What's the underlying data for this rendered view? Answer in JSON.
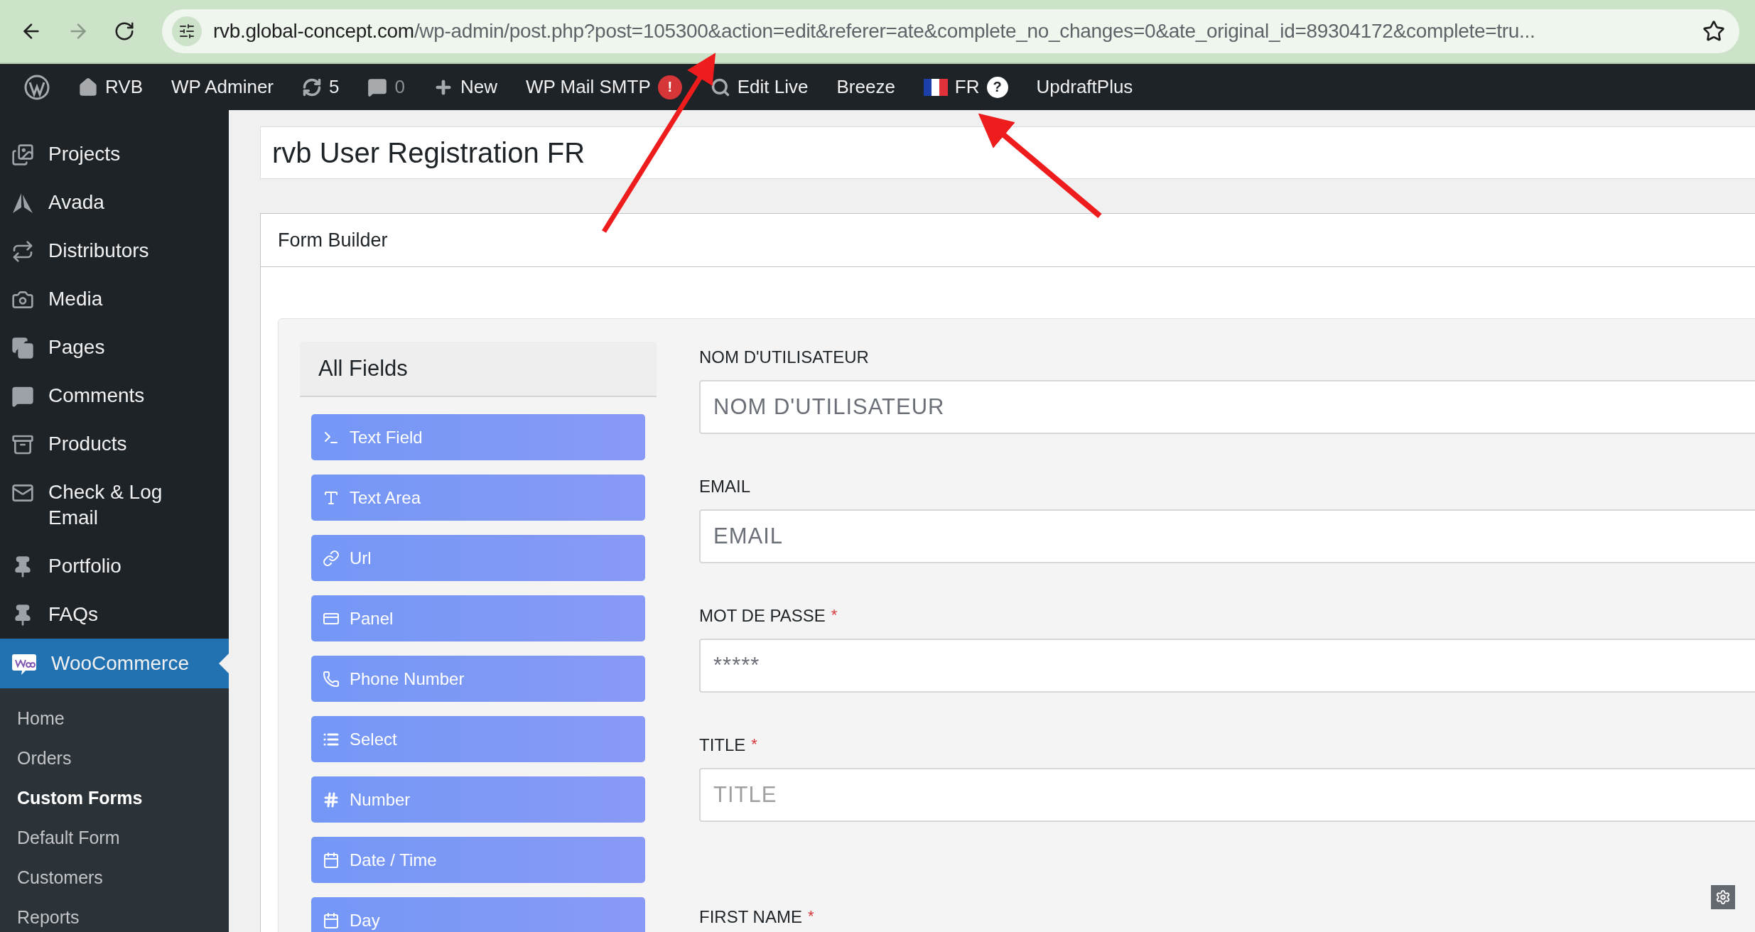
{
  "browser": {
    "url_host": "rvb.global-concept.com",
    "url_path": "/wp-admin/post.php?post=105300&action=edit&referer=ate&complete_no_changes=0&ate_original_id=89304172&complete=tru..."
  },
  "admin_bar": [
    {
      "kind": "wp-logo"
    },
    {
      "kind": "home",
      "label": "RVB"
    },
    {
      "kind": "text",
      "label": "WP Adminer"
    },
    {
      "kind": "updates",
      "label": "5"
    },
    {
      "kind": "comments",
      "label": "0"
    },
    {
      "kind": "new",
      "label": "New"
    },
    {
      "kind": "alert",
      "label": "WP Mail SMTP",
      "badge": "!"
    },
    {
      "kind": "search",
      "label": "Edit Live"
    },
    {
      "kind": "text",
      "label": "Breeze"
    },
    {
      "kind": "language",
      "label": "FR",
      "badge": "?"
    },
    {
      "kind": "text",
      "label": "UpdraftPlus"
    }
  ],
  "sidebar": {
    "items": [
      {
        "label": "Projects",
        "selected": false
      },
      {
        "label": "Avada",
        "selected": false
      },
      {
        "label": "Distributors",
        "selected": false
      },
      {
        "label": "Media",
        "selected": false
      },
      {
        "label": "Pages",
        "selected": false
      },
      {
        "label": "Comments",
        "selected": false
      },
      {
        "label": "Products",
        "selected": false
      },
      {
        "label": "Check & Log Email",
        "selected": false
      },
      {
        "label": "Portfolio",
        "selected": false
      },
      {
        "label": "FAQs",
        "selected": false
      },
      {
        "label": "WooCommerce",
        "selected": true
      }
    ],
    "submenu": [
      {
        "label": "Home",
        "selected": false
      },
      {
        "label": "Orders",
        "selected": false
      },
      {
        "label": "Custom Forms",
        "selected": true
      },
      {
        "label": "Default Form",
        "selected": false
      },
      {
        "label": "Customers",
        "selected": false
      },
      {
        "label": "Reports",
        "selected": false
      }
    ]
  },
  "post_title": "rvb User Registration FR",
  "form_builder": {
    "title": "Form Builder",
    "fields_panel_title": "All Fields",
    "field_types": [
      {
        "label": "Text Field"
      },
      {
        "label": "Text Area"
      },
      {
        "label": "Url"
      },
      {
        "label": "Panel"
      },
      {
        "label": "Phone Number"
      },
      {
        "label": "Select"
      },
      {
        "label": "Number"
      },
      {
        "label": "Date / Time"
      },
      {
        "label": "Day"
      }
    ],
    "form_fields": [
      {
        "label": "NOM D'UTILISATEUR",
        "placeholder": "NOM D'UTILISATEUR"
      },
      {
        "label": "EMAIL",
        "placeholder": "EMAIL"
      },
      {
        "label": "MOT DE PASSE",
        "required_mark": "*",
        "placeholder": "*****"
      },
      {
        "label": "TITLE",
        "required_mark": "*",
        "placeholder": "TITLE"
      },
      {
        "label": "FIRST NAME",
        "required_mark": "*"
      }
    ]
  }
}
